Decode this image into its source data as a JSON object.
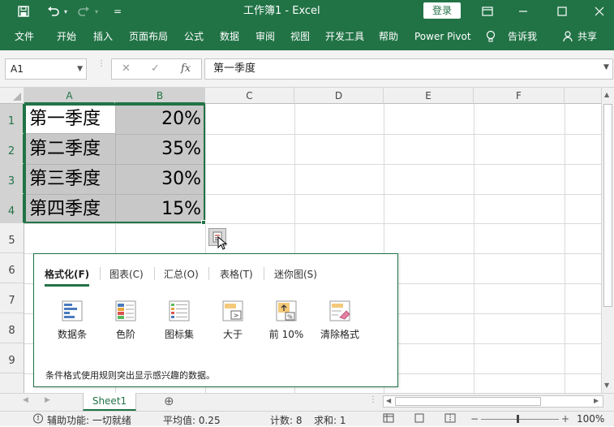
{
  "titlebar": {
    "title": "工作簿1  -  Excel",
    "login": "登录",
    "qat_menu": "="
  },
  "ribbon": {
    "tabs": [
      "文件",
      "开始",
      "插入",
      "页面布局",
      "公式",
      "数据",
      "审阅",
      "视图",
      "开发工具",
      "帮助",
      "Power Pivot"
    ],
    "tell_me": "告诉我",
    "share": "共享"
  },
  "formula_bar": {
    "name_box": "A1",
    "fx": "fx",
    "cancel": "✕",
    "enter": "✓",
    "content": "第一季度"
  },
  "columns": [
    "A",
    "B",
    "C",
    "D",
    "E",
    "F"
  ],
  "rows": [
    "1",
    "2",
    "3",
    "4",
    "5",
    "6",
    "7",
    "8",
    "9"
  ],
  "cells": [
    {
      "label": "第一季度",
      "value": "20%"
    },
    {
      "label": "第二季度",
      "value": "35%"
    },
    {
      "label": "第三季度",
      "value": "30%"
    },
    {
      "label": "第四季度",
      "value": "15%"
    }
  ],
  "quick_analysis": {
    "tabs": [
      "格式化(F)",
      "图表(C)",
      "汇总(O)",
      "表格(T)",
      "迷你图(S)"
    ],
    "options": [
      "数据条",
      "色阶",
      "图标集",
      "大于",
      "前 10%",
      "清除格式"
    ],
    "description": "条件格式使用规则突出显示感兴趣的数据。"
  },
  "sheet": {
    "tab": "Sheet1",
    "add": "⊕"
  },
  "status": {
    "accessibility": "辅助功能: 一切就绪",
    "average": "平均值: 0.25",
    "count": "计数: 8",
    "sum": "求和: 1",
    "zoom": "100%"
  },
  "colors": {
    "accent": "#217346",
    "selection": "#c8c8c8"
  }
}
